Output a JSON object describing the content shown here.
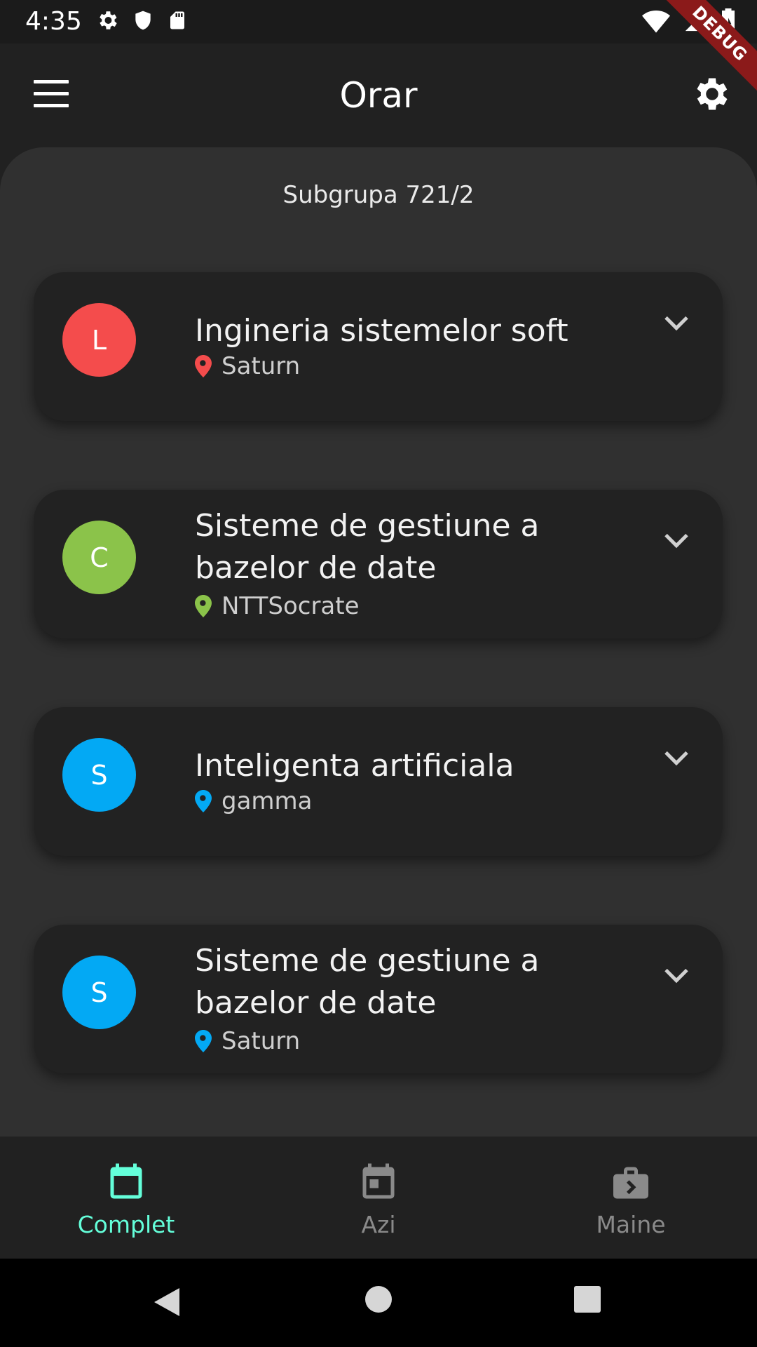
{
  "status_bar": {
    "time": "4:35",
    "icons_left": [
      "gear-icon",
      "shield-icon",
      "sd-card-icon"
    ],
    "icons_right": [
      "wifi-icon",
      "cell-signal-icon",
      "battery-icon"
    ],
    "debug_label": "DEBUG"
  },
  "app_bar": {
    "title": "Orar",
    "menu_icon": "menu-icon",
    "settings_icon": "gear-icon"
  },
  "content": {
    "subgroup": "Subgrupa 721/2",
    "cards": [
      {
        "avatar_letter": "L",
        "avatar_color": "#f44c4c",
        "title": "Ingineria sistemelor soft",
        "location": "Saturn",
        "pin_color": "#f44c4c"
      },
      {
        "avatar_letter": "C",
        "avatar_color": "#8bc34a",
        "title": "Sisteme de gestiune a bazelor de date",
        "location": "NTTSocrate",
        "pin_color": "#8bc34a"
      },
      {
        "avatar_letter": "S",
        "avatar_color": "#03a9f4",
        "title": "Inteligenta artificiala",
        "location": "gamma",
        "pin_color": "#03a9f4"
      },
      {
        "avatar_letter": "S",
        "avatar_color": "#03a9f4",
        "title": "Sisteme de gestiune a bazelor de date",
        "location": "Saturn",
        "pin_color": "#03a9f4"
      }
    ]
  },
  "bottom_nav": {
    "items": [
      {
        "label": "Complet",
        "icon": "calendar-icon",
        "active": true
      },
      {
        "label": "Azi",
        "icon": "calendar-today-icon",
        "active": false
      },
      {
        "label": "Maine",
        "icon": "next-week-icon",
        "active": false
      }
    ],
    "active_color": "#64ffda",
    "inactive_color": "#8a8a8a"
  },
  "system_nav": {
    "buttons": [
      "back-icon",
      "home-icon",
      "recents-icon"
    ]
  }
}
